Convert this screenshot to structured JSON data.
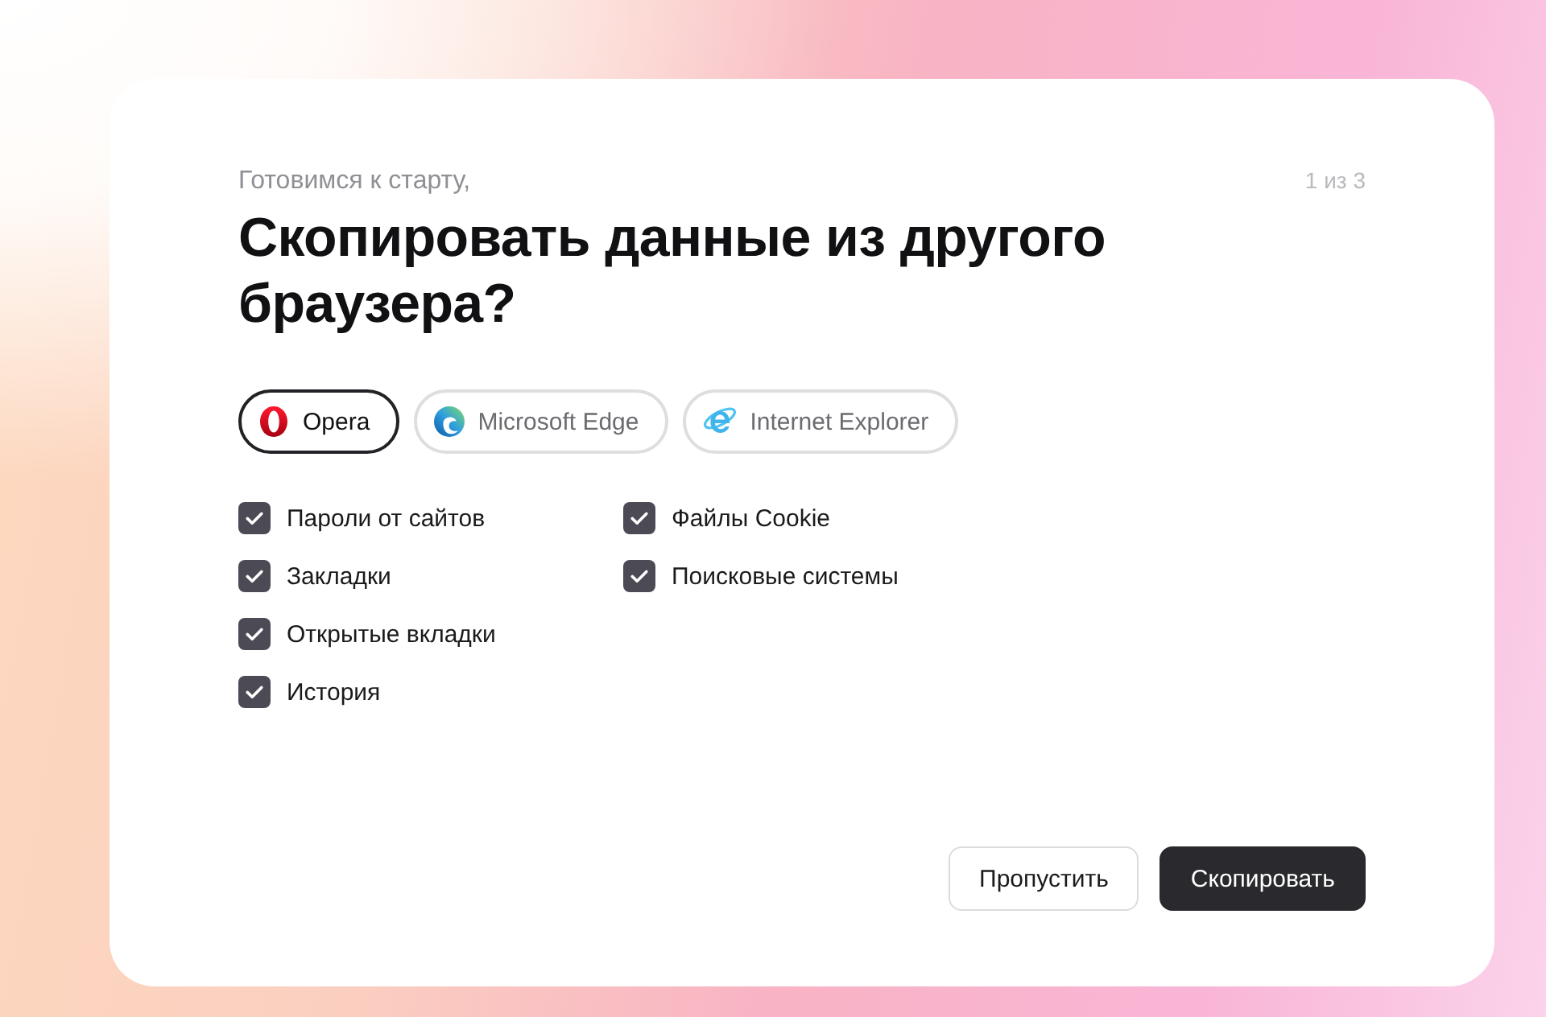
{
  "header": {
    "subtitle": "Готовимся к старту,",
    "step": "1 из 3",
    "title": "Скопировать данные из другого браузера?"
  },
  "browsers": [
    {
      "name": "Opera",
      "kind": "opera",
      "selected": true
    },
    {
      "name": "Microsoft Edge",
      "kind": "edge",
      "selected": false
    },
    {
      "name": "Internet Explorer",
      "kind": "ie",
      "selected": false
    }
  ],
  "option_columns": [
    [
      {
        "label": "Пароли от сайтов",
        "checked": true
      },
      {
        "label": "Закладки",
        "checked": true
      },
      {
        "label": "Открытые вкладки",
        "checked": true
      },
      {
        "label": "История",
        "checked": true
      }
    ],
    [
      {
        "label": "Файлы Cookie",
        "checked": true
      },
      {
        "label": "Поисковые системы",
        "checked": true
      }
    ]
  ],
  "buttons": [
    {
      "label": "Пропустить",
      "kind": "secondary"
    },
    {
      "label": "Скопировать",
      "kind": "primary"
    }
  ]
}
